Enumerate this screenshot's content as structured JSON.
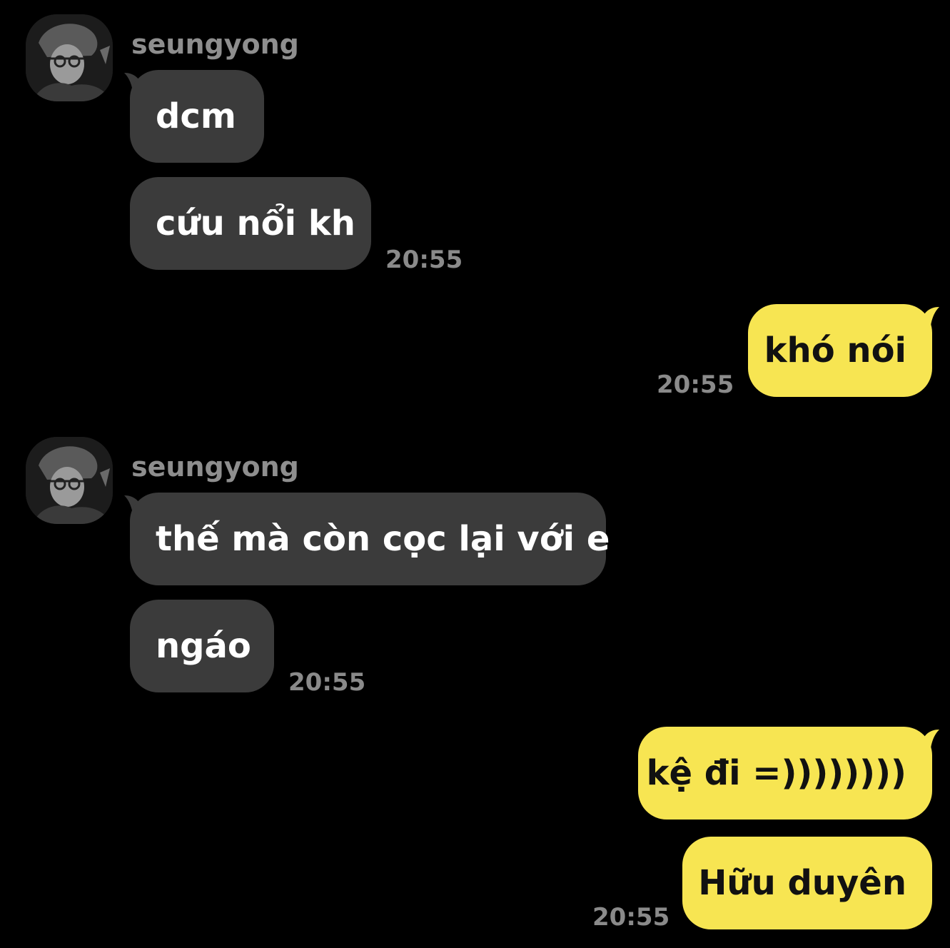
{
  "colors": {
    "background": "#000000",
    "incoming_bubble": "#3b3b3b",
    "outgoing_bubble": "#f7e552",
    "timestamp": "#8a8a8a",
    "sender_name": "#8e8e8e"
  },
  "chat": {
    "group1": {
      "sender": "seungyong",
      "avatar_icon": "profile-photo-icon",
      "messages": [
        "dcm",
        "cứu nổi kh"
      ],
      "time": "20:55"
    },
    "reply1": {
      "messages": [
        "khó nói"
      ],
      "time": "20:55"
    },
    "group2": {
      "sender": "seungyong",
      "avatar_icon": "profile-photo-icon",
      "messages": [
        "thế mà còn cọc lại với e",
        "ngáo"
      ],
      "time": "20:55"
    },
    "reply2": {
      "messages": [
        "kệ đi =))))))))",
        "Hữu duyên"
      ],
      "time": "20:55"
    }
  }
}
